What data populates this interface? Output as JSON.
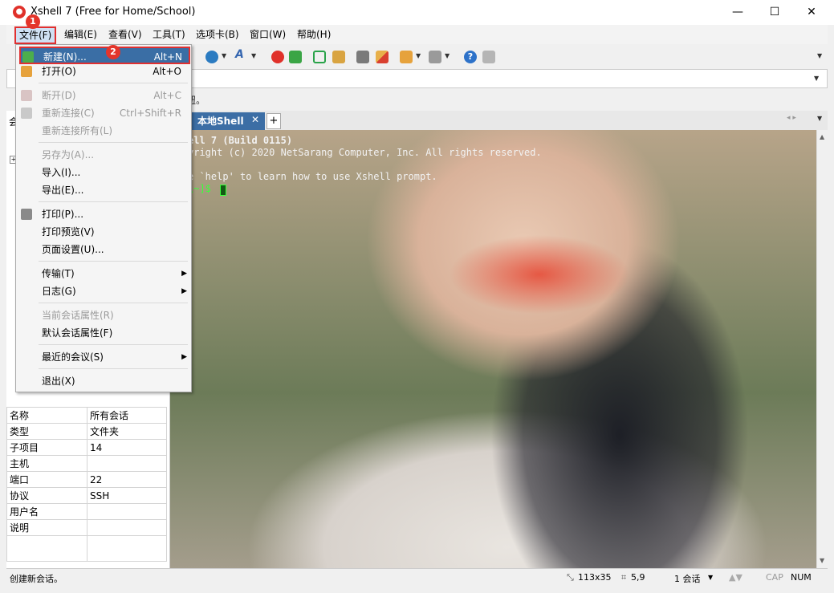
{
  "window": {
    "title": "Xshell 7 (Free for Home/School)",
    "minimize": "—",
    "maximize": "☐",
    "close": "✕"
  },
  "menubar": {
    "items": [
      "文件(F)",
      "编辑(E)",
      "查看(V)",
      "工具(T)",
      "选项卡(B)",
      "窗口(W)",
      "帮助(H)"
    ]
  },
  "file_menu": {
    "items": [
      {
        "label": "新建(N)...",
        "shortcut": "Alt+N"
      },
      {
        "label": "打开(O)",
        "shortcut": "Alt+O"
      },
      {
        "label": "断开(D)",
        "shortcut": "Alt+C"
      },
      {
        "label": "重新连接(C)",
        "shortcut": "Ctrl+Shift+R"
      },
      {
        "label": "重新连接所有(L)",
        "shortcut": ""
      },
      {
        "label": "另存为(A)...",
        "shortcut": ""
      },
      {
        "label": "导入(I)...",
        "shortcut": ""
      },
      {
        "label": "导出(E)...",
        "shortcut": ""
      },
      {
        "label": "打印(P)...",
        "shortcut": ""
      },
      {
        "label": "打印预览(V)",
        "shortcut": ""
      },
      {
        "label": "页面设置(U)...",
        "shortcut": ""
      },
      {
        "label": "传输(T)",
        "shortcut": ""
      },
      {
        "label": "日志(G)",
        "shortcut": ""
      },
      {
        "label": "当前会话属性(R)",
        "shortcut": ""
      },
      {
        "label": "默认会话属性(F)",
        "shortcut": ""
      },
      {
        "label": "最近的会议(S)",
        "shortcut": ""
      },
      {
        "label": "退出(X)",
        "shortcut": ""
      }
    ]
  },
  "badges": {
    "step1": "1",
    "step2": "2"
  },
  "infobar": {
    "hint": "钮。"
  },
  "tabs": {
    "active": "本地Shell",
    "close": "✕",
    "add": "+"
  },
  "terminal": {
    "lines": [
      "ell 7 (Build 0115)",
      "yright (c) 2020 NetSarang Computer, Inc. All rights reserved.",
      "",
      "e `help' to learn how to use Xshell prompt.",
      "\\~]$ "
    ]
  },
  "properties": {
    "rows": [
      {
        "k": "名称",
        "v": "所有会话"
      },
      {
        "k": "类型",
        "v": "文件夹"
      },
      {
        "k": "子项目",
        "v": "14"
      },
      {
        "k": "主机",
        "v": ""
      },
      {
        "k": "端口",
        "v": "22"
      },
      {
        "k": "协议",
        "v": "SSH"
      },
      {
        "k": "用户名",
        "v": ""
      },
      {
        "k": "说明",
        "v": ""
      }
    ]
  },
  "leftpanel": {
    "header_fragment": "会"
  },
  "statusbar": {
    "message": "创建新会话。",
    "size": "113x35",
    "position": "5,9",
    "sessions": "1 会话",
    "cap": "CAP",
    "num": "NUM"
  },
  "colors": {
    "accent": "#3a6ea5",
    "highlight_border": "#e03030",
    "badge": "#e4352b"
  }
}
